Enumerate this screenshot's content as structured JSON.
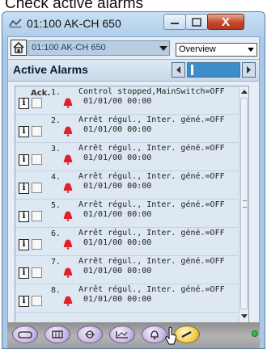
{
  "page_heading": "Check active alarms",
  "window": {
    "title": "01:100 AK-CH 650",
    "minimize_label": "–",
    "maximize_label": "□",
    "close_label": "X"
  },
  "toolbar": {
    "device": "01:100 AK-CH 650",
    "view": "Overview"
  },
  "header": {
    "title": "Active Alarms"
  },
  "list": {
    "col_ack": "Ack.",
    "rows": [
      {
        "num": "1.",
        "text": "Control stopped,MainSwitch=OFF",
        "time": "01/01/00 00:00"
      },
      {
        "num": "2.",
        "text": "Arrêt régul., Inter. géné.=OFF",
        "time": "01/01/00 00:00"
      },
      {
        "num": "3.",
        "text": "Arrêt régul., Inter. géné.=OFF",
        "time": "01/01/00 00:00"
      },
      {
        "num": "4.",
        "text": "Arrêt régul., Inter. géné.=OFF",
        "time": "01/01/00 00:00"
      },
      {
        "num": "5.",
        "text": "Arrêt régul., Inter. géné.=OFF",
        "time": "01/01/00 00:00"
      },
      {
        "num": "6.",
        "text": "Arrêt régul., Inter. géné.=OFF",
        "time": "01/01/00 00:00"
      },
      {
        "num": "7.",
        "text": "Arrêt régul., Inter. géné.=OFF",
        "time": "01/01/00 00:00"
      },
      {
        "num": "8.",
        "text": "Arrêt régul., Inter. géné.=OFF",
        "time": "01/01/00 00:00"
      }
    ],
    "info_label": "i"
  },
  "actions": {
    "delete": "✕",
    "refresh": "⇅",
    "prev": "◄",
    "next": "►"
  },
  "icons": {
    "alarm": "red-alarm-bell-icon",
    "nav": [
      "controller-icon",
      "keypad-icon",
      "compressor-icon",
      "graph-icon",
      "alarm-bell-icon",
      "service-icon"
    ]
  },
  "colors": {
    "alarm_red": "#e0202a",
    "header_accent": "#3b8ec9",
    "status_green": "#27c24a"
  }
}
